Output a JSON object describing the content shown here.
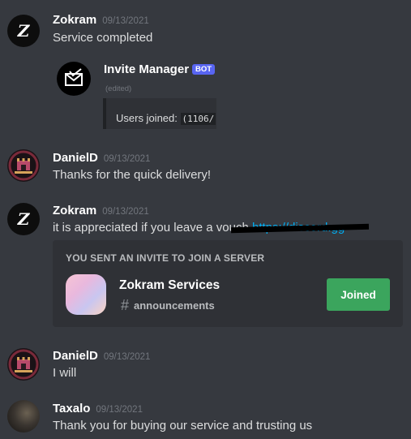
{
  "messages": [
    {
      "author": "Zokram",
      "timestamp": "09/13/2021",
      "text": "Service completed"
    },
    {
      "author": "DanielD",
      "timestamp": "09/13/2021",
      "text": "Thanks for the quick delivery!"
    },
    {
      "author": "Zokram",
      "timestamp": "09/13/2021",
      "text": "it is appreciated if you leave a vouch",
      "link": "https://discord.gg"
    },
    {
      "author": "DanielD",
      "timestamp": "09/13/2021",
      "text": "I will"
    },
    {
      "author": "Taxalo",
      "timestamp": "09/13/2021",
      "text": "Thank you for buying our service and trusting us"
    }
  ],
  "bot_reply": {
    "name": "Invite Manager",
    "tag": "BOT",
    "edited": "(edited)",
    "embed_label": "Users joined:",
    "embed_value": "(1106/"
  },
  "invite": {
    "header": "YOU SENT AN INVITE TO JOIN A SERVER",
    "server_name": "Zokram Services",
    "channel": "announcements",
    "button_label": "Joined"
  },
  "avatar_initial": "Z",
  "colors": {
    "background": "#36393f",
    "link": "#00aff4",
    "bot_tag": "#5865f2",
    "joined_button": "#3ba55d",
    "card": "#2f3136"
  }
}
